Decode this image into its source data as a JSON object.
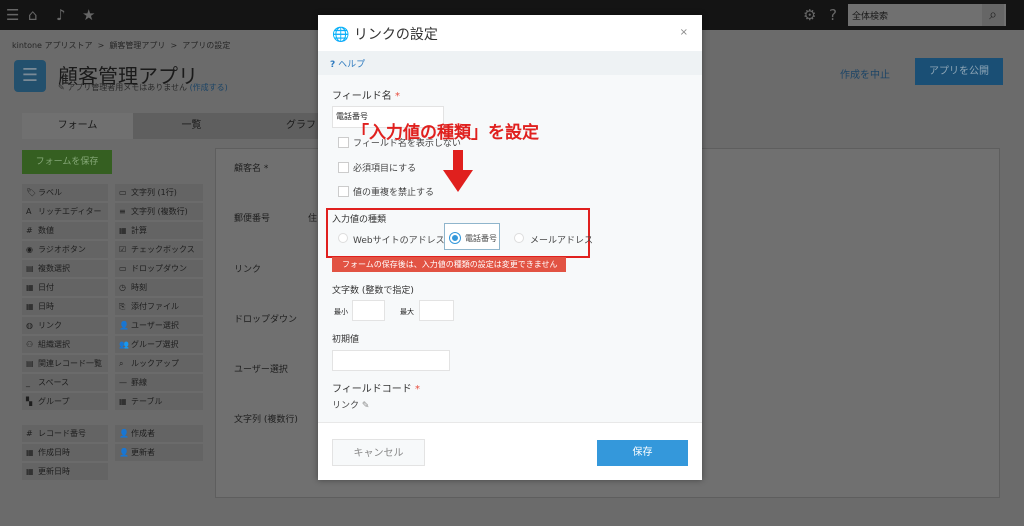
{
  "topbar": {
    "search_placeholder": "全体検索"
  },
  "breadcrumb": [
    "kintone アプリストア",
    ">",
    "顧客管理アプリ",
    ">",
    "アプリの設定"
  ],
  "app": {
    "title": "顧客管理アプリ",
    "memo": "アプリ管理者用メモはありません",
    "memo_link": "(作成する)",
    "cancel_label": "作成を中止",
    "publish_label": "アプリを公開"
  },
  "tabs": [
    {
      "label": "フォーム"
    },
    {
      "label": "一覧"
    },
    {
      "label": "グラフ"
    }
  ],
  "save_form_label": "フォームを保存",
  "palette": [
    [
      "ラベル",
      "文字列 (1行)"
    ],
    [
      "リッチエディター",
      "文字列 (複数行)"
    ],
    [
      "数値",
      "計算"
    ],
    [
      "ラジオボタン",
      "チェックボックス"
    ],
    [
      "複数選択",
      "ドロップダウン"
    ],
    [
      "日付",
      "時刻"
    ],
    [
      "日時",
      "添付ファイル"
    ],
    [
      "リンク",
      "ユーザー選択"
    ],
    [
      "組織選択",
      "グループ選択"
    ],
    [
      "関連レコード一覧",
      "ルックアップ"
    ],
    [
      "スペース",
      "罫線"
    ],
    [
      "グループ",
      "テーブル"
    ]
  ],
  "palette_system": [
    [
      "レコード番号",
      "作成者"
    ],
    [
      "作成日時",
      "更新者"
    ],
    [
      "更新日時",
      ""
    ]
  ],
  "canvas_fields": [
    "顧客名 *",
    "郵便番号",
    "住",
    "リンク",
    "ドロップダウン",
    "ユーザー選択",
    "文字列 (複数行)"
  ],
  "modal": {
    "title": "リンクの設定",
    "close": "×",
    "help": "ヘルプ",
    "field_name_label": "フィールド名",
    "required_mark": "*",
    "field_name_value": "電話番号",
    "checkboxes": [
      "フィールド名を表示しない",
      "必須項目にする",
      "値の重複を禁止する"
    ],
    "input_type_label": "入力値の種類",
    "input_types": [
      {
        "label": "Webサイトのアドレス",
        "selected": false
      },
      {
        "label": "電話番号",
        "selected": true
      },
      {
        "label": "メールアドレス",
        "selected": false
      }
    ],
    "warning": "フォームの保存後は、入力値の種類の設定は変更できません",
    "length_label": "文字数 (整数で指定)",
    "min_label": "最小",
    "max_label": "最大",
    "default_label": "初期値",
    "field_code_label": "フィールドコード",
    "field_code_value": "リンク",
    "cancel_label": "キャンセル",
    "save_label": "保存"
  },
  "annotation": {
    "text": "「入力値の種類」を設定",
    "color": "#e0201e"
  }
}
